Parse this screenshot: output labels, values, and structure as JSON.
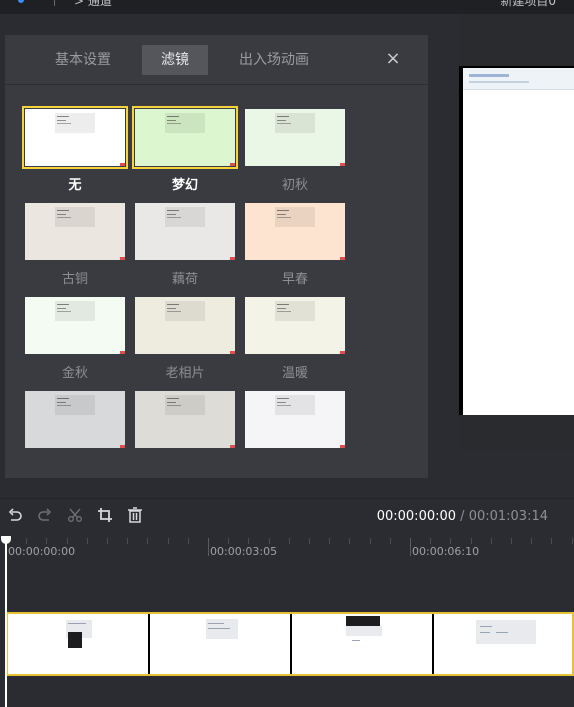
{
  "topbar": {
    "left_text": "> 通道",
    "right_text": "新建项目0"
  },
  "panel": {
    "tabs": [
      {
        "label": "基本设置",
        "active": false
      },
      {
        "label": "滤镜",
        "active": true
      },
      {
        "label": "出入场动画",
        "active": false
      }
    ],
    "close_symbol": "×",
    "filters": [
      {
        "name": "无",
        "tint": "#ffffff",
        "selected": true,
        "bold": true
      },
      {
        "name": "梦幻",
        "tint": "#dcf7cf",
        "selected": true,
        "bold": true
      },
      {
        "name": "初秋",
        "tint": "#eaf6e6",
        "selected": false,
        "bold": false
      },
      {
        "name": "古铜",
        "tint": "#ece6e0",
        "selected": false,
        "bold": false
      },
      {
        "name": "藕荷",
        "tint": "#e9e8e6",
        "selected": false,
        "bold": false
      },
      {
        "name": "早春",
        "tint": "#fde4d1",
        "selected": false,
        "bold": false
      },
      {
        "name": "金秋",
        "tint": "#f4fbf3",
        "selected": false,
        "bold": false
      },
      {
        "name": "老相片",
        "tint": "#eeebdf",
        "selected": false,
        "bold": false
      },
      {
        "name": "温暖",
        "tint": "#f3f3e7",
        "selected": false,
        "bold": false
      },
      {
        "name": "",
        "tint": "#d8d9db",
        "selected": false,
        "bold": false
      },
      {
        "name": "",
        "tint": "#dedcd6",
        "selected": false,
        "bold": false
      },
      {
        "name": "",
        "tint": "#f5f4f6",
        "selected": false,
        "bold": false
      }
    ]
  },
  "timeline": {
    "tools": [
      "undo-icon",
      "redo-icon",
      "scissors-icon",
      "crop-icon",
      "trash-icon"
    ],
    "current_time": "00:00:00:00",
    "separator": " / ",
    "total_time": "00:01:03:14",
    "ruler_labels": [
      "00:00:00:00",
      "00:00:03:05",
      "00:00:06:10"
    ]
  },
  "colors": {
    "accent_yellow": "#f6d33b",
    "panel_bg": "#3a3b40",
    "active_tab_bg": "#55565b"
  }
}
